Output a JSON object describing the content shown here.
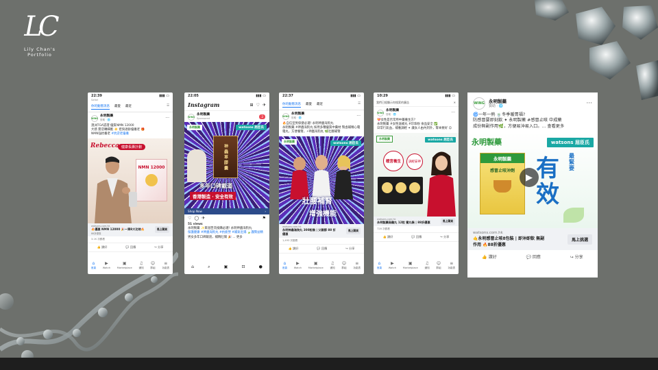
{
  "logo": {
    "mark": "LC",
    "caption": "Lily Chan's Portfolio"
  },
  "colors": {
    "background": "#6d706c",
    "facebook_blue": "#1877f2",
    "watsons_teal": "#1aa8a4",
    "bottom_bar": "#1e1e1e"
  },
  "phones": [
    {
      "time": "22:39",
      "carrier": "Safari",
      "tabs": [
        "你的動態消息",
        "最愛",
        "最近"
      ],
      "page_name": "永明製藥",
      "meta": "贊助 · 🌐",
      "text_a": "澳洲TGA認證 優質NMN 12000",
      "text_b": "大感 需逆轉細胞 ☀️ 拒快退齡優養老 🎁",
      "text_c": "NMN強抗養老",
      "hashtag": "#抗逆老優養",
      "brand_tag": "Rebecca",
      "product": "NMN 12000",
      "banner": "健康長壽計劃",
      "link_url": "watsons.com.hk",
      "link_title": "🔥優惠 NMN 12000 🎉一齊8大功效🔥",
      "link_desc": "88折優惠",
      "cta": "馬上購買",
      "reactions": "3.1K 次觀看",
      "actions": [
        "👍 讚好",
        "💬 回應",
        "↪ 分享"
      ],
      "nav": [
        "首頁",
        "Watch",
        "Marketplace",
        "通知",
        "群組",
        "功能表"
      ]
    },
    {
      "time": "22:05",
      "app": "Instagram",
      "badge": "2",
      "page_name": "永明製藥",
      "meta": "Sponsored",
      "watsons": "watsons 屈臣氏",
      "box_text": "神 蟲 草 膠 囊",
      "headline_1": "多年口碑載道",
      "headline_2": "香港製造 · 安全有效",
      "shop": "Shop Now",
      "views": "51 views",
      "caption_a": "永明製藥 ✨來屈臣氏換購必選! 永明神蟲海狗丸",
      "caption_b": "保護健康 #神蟲海狗丸 #抗疲勞 #補氣壯陽 🍃護腎益精",
      "caption_c": "男女多年口碑載道，補精壯陽 🎉 ... 更多"
    },
    {
      "time": "22:37",
      "tabs": [
        "你的動態消息",
        "最愛",
        "最近"
      ],
      "page_name": "永明製藥",
      "meta": "贊助 · 🌐",
      "text_a": "🔥自信型男保健必選! 永明神蟲海狗丸",
      "text_b": "永明製藥 #神蟲海狗丸 採用多種優質中藥材 腎虛補精心電電丸，方便養腎，⚡神蟲海狗丸 🌿壯腰補腎",
      "watsons": "watsons 屈臣氏",
      "headline_1": "壯腰補腎",
      "headline_2": "增強機能",
      "link_url": "watsons.com.hk",
      "link_title": "永明神蟲海狗丸 300粒裝 | 父親節 88 折優惠",
      "cta": "馬上購買",
      "reactions": "1,493 次觀看"
    },
    {
      "time": "10:29",
      "header": "我們已經顯示你搜索的廣告",
      "page_name": "永明製藥",
      "meta": "贊助 · 🌐",
      "text_a": "💝女性是否常用中藥養生方?",
      "text_b": "永明製藥 #女性滋補丸 #珍珠粉 食品安全 ✅",
      "text_c": "日常行氣血，補養調經 ✦ 讓女人由內到外，腎本要好 😊",
      "watsons": "watsons 屈臣氏",
      "badge_a": "暖宮養生",
      "badge_b": "調經安神",
      "link_url": "watsons.com.hk",
      "link_title": "永明製藥烏雞丸 12粒 蜜丸裝 | 88折優惠",
      "cta": "馬上購買",
      "reactions": "728 次觀看"
    }
  ],
  "tall_card": {
    "page_name": "永明製藥",
    "meta": "贊助 · 🌐",
    "text_a": "🌀一年一熱 🍵冬季暖胃福?",
    "text_b": "防感冒要即刻飲 ✦ 永明製藥 #感冒止咳 中成藥",
    "text_c": "成份無副作用🌿，方便易沖易入口。... 查看更多",
    "brand_cn": "永明製藥",
    "watsons": "watsons 屈臣氏",
    "product_name": "感冒止咳沖劑",
    "headline_small": "最緊要",
    "headline_big": "有效",
    "link_url": "watsons.com.hk",
    "link_title": "🤙永明感冒止咳8包裝 | 即沖即飲 無副作用 🔥88折優惠",
    "cta": "馬上挑選",
    "actions": [
      "👍 讚好",
      "💬 回應",
      "↪ 分享"
    ]
  }
}
